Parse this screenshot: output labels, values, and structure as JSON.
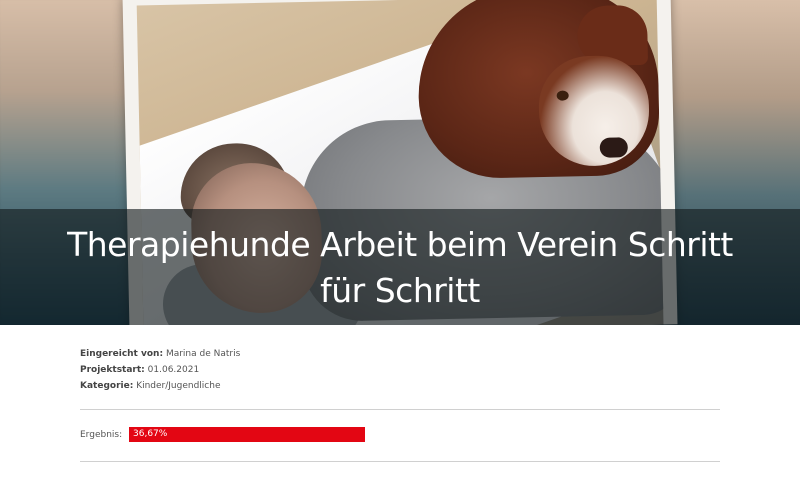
{
  "hero": {
    "title": "Therapiehunde Arbeit beim Verein Schritt für Schritt"
  },
  "project": {
    "submitted_label": "Eingereicht von:",
    "submitted_value": "Marina de Natris",
    "start_label": "Projektstart:",
    "start_value": "01.06.2021",
    "category_label": "Kategorie:",
    "category_value": "Kinder/Jugendliche"
  },
  "result": {
    "label": "Ergebnis:",
    "value_text": "36,67%",
    "bar_color": "#e30613"
  }
}
